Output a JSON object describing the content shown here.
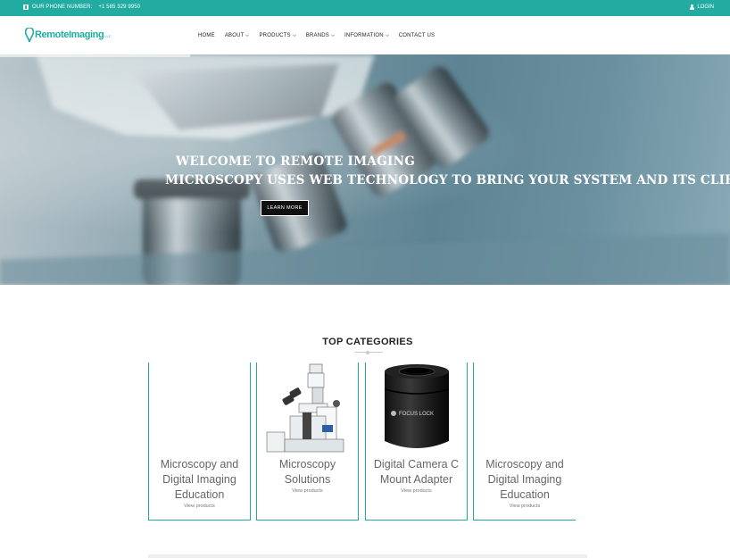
{
  "topbar": {
    "phone_label": "OUR PHONE NUMBER:",
    "phone_number": "+1 585 329 9950",
    "login_label": "LOGIN"
  },
  "header": {
    "logo_text": "RemoteImaging",
    "logo_suffix": "LLC",
    "nav": [
      {
        "label": "HOME",
        "has_dropdown": false
      },
      {
        "label": "ABOUT",
        "has_dropdown": true
      },
      {
        "label": "PRODUCTS",
        "has_dropdown": true
      },
      {
        "label": "BRANDS",
        "has_dropdown": true
      },
      {
        "label": "INFORMATION",
        "has_dropdown": true
      },
      {
        "label": "CONTACT US",
        "has_dropdown": false
      }
    ]
  },
  "hero": {
    "welcome": "WELCOME TO REMOTE IMAGING",
    "tagline": "MICROSCOPY USES WEB TECHNOLOGY TO BRING YOUR SYSTEM AND ITS CLIENTS TOGETHER",
    "button_label": "LEARN MORE"
  },
  "categories": {
    "title": "TOP CATEGORIES",
    "items": [
      {
        "name": "Microscopy and Digital Imaging Education",
        "link": "View products",
        "image": "none"
      },
      {
        "name": "Microscopy Solutions",
        "link": "View products",
        "image": "inverted-microscope"
      },
      {
        "name": "Digital Camera C Mount Adapter",
        "link": "View products",
        "image": "c-mount-adapter"
      },
      {
        "name": "Microscopy and Digital Imaging Education",
        "link": "View products",
        "image": "none"
      }
    ]
  },
  "colors": {
    "accent": "#21aba1",
    "button": "#111111"
  }
}
